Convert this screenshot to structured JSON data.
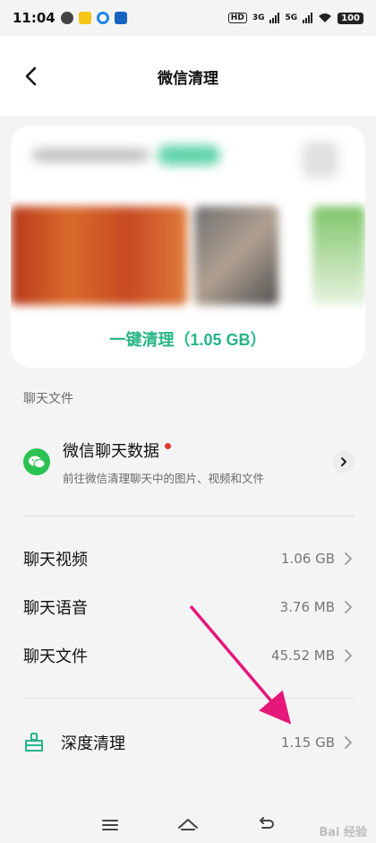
{
  "status_bar": {
    "time": "11:04",
    "hd": "HD",
    "net1": "3G",
    "net2": "5G",
    "battery": "100"
  },
  "header": {
    "title": "微信清理",
    "back_icon": "chevron-left-icon"
  },
  "card": {
    "clean_button_label": "一键清理（1.05 GB）",
    "accent_color": "#27b587"
  },
  "chat_files_section": {
    "label": "聊天文件"
  },
  "wechat_data": {
    "title": "微信聊天数据",
    "subtitle": "前往微信清理聊天中的图片、视频和文件",
    "has_badge": true
  },
  "items": [
    {
      "label": "聊天视频",
      "value": "1.06 GB"
    },
    {
      "label": "聊天语音",
      "value": "3.76 MB"
    },
    {
      "label": "聊天文件",
      "value": "45.52 MB"
    }
  ],
  "deep_clean": {
    "label": "深度清理",
    "value": "1.15 GB",
    "icon": "broom-icon"
  },
  "bottom_nav": {
    "menu_icon": "menu-icon",
    "home_icon": "home-icon",
    "back_icon": "return-icon"
  },
  "watermark": "Bai 经验"
}
